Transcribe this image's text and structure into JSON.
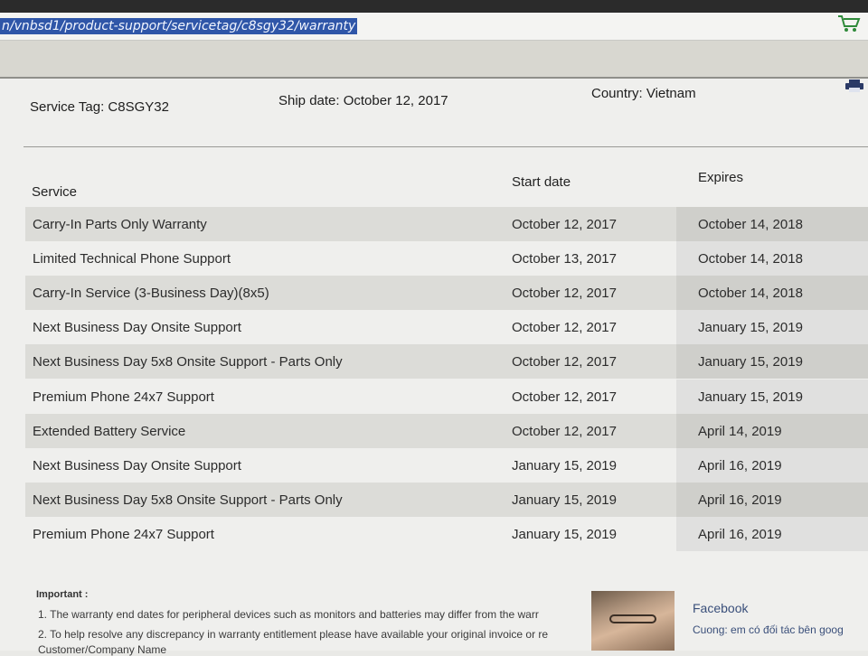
{
  "browser": {
    "url_selected": "n/vnbsd1/product-support/servicetag/c8sgy32/warranty"
  },
  "header": {
    "service_tag": "Service Tag: C8SGY32",
    "ship_date": "Ship date: October 12, 2017",
    "country": "Country: Vietnam"
  },
  "table": {
    "columns": [
      "Service",
      "Start date",
      "Expires"
    ],
    "rows": [
      {
        "service": "Carry-In Parts Only Warranty",
        "start": "October 12, 2017",
        "expires": "October 14, 2018"
      },
      {
        "service": "Limited Technical Phone Support",
        "start": "October 13, 2017",
        "expires": "October 14, 2018"
      },
      {
        "service": "Carry-In Service (3-Business Day)(8x5)",
        "start": "October 12, 2017",
        "expires": "October 14, 2018"
      },
      {
        "service": "Next Business Day Onsite Support",
        "start": "October 12, 2017",
        "expires": "January 15, 2019"
      },
      {
        "service": "Next Business Day 5x8 Onsite Support - Parts Only",
        "start": "October 12, 2017",
        "expires": "January 15, 2019"
      },
      {
        "service": "Premium Phone 24x7 Support",
        "start": "October 12, 2017",
        "expires": "January 15, 2019"
      },
      {
        "service": "Extended Battery Service",
        "start": "October 12, 2017",
        "expires": "April 14, 2019"
      },
      {
        "service": "Next Business Day Onsite Support",
        "start": "January 15, 2019",
        "expires": "April 16, 2019"
      },
      {
        "service": "Next Business Day 5x8 Onsite Support - Parts Only",
        "start": "January 15, 2019",
        "expires": "April 16, 2019"
      },
      {
        "service": "Premium Phone 24x7 Support",
        "start": "January 15, 2019",
        "expires": "April 16, 2019"
      }
    ]
  },
  "important": {
    "title": "Important :",
    "lines": [
      "1. The warranty end dates for peripheral devices such as monitors and batteries may differ from the warr",
      "2. To help resolve any discrepancy in warranty entitlement please have available your original invoice or re",
      "Customer/Company Name"
    ]
  },
  "facebook_popup": {
    "title": "Facebook",
    "text": "Cuong: em có đối tác bên goog"
  },
  "icons": [
    "cart-icon",
    "print-icon"
  ],
  "colors": {
    "url_highlight": "#2f56a8",
    "row_shade": "#dcdcd8",
    "facebook_text": "#3a4f7a"
  }
}
